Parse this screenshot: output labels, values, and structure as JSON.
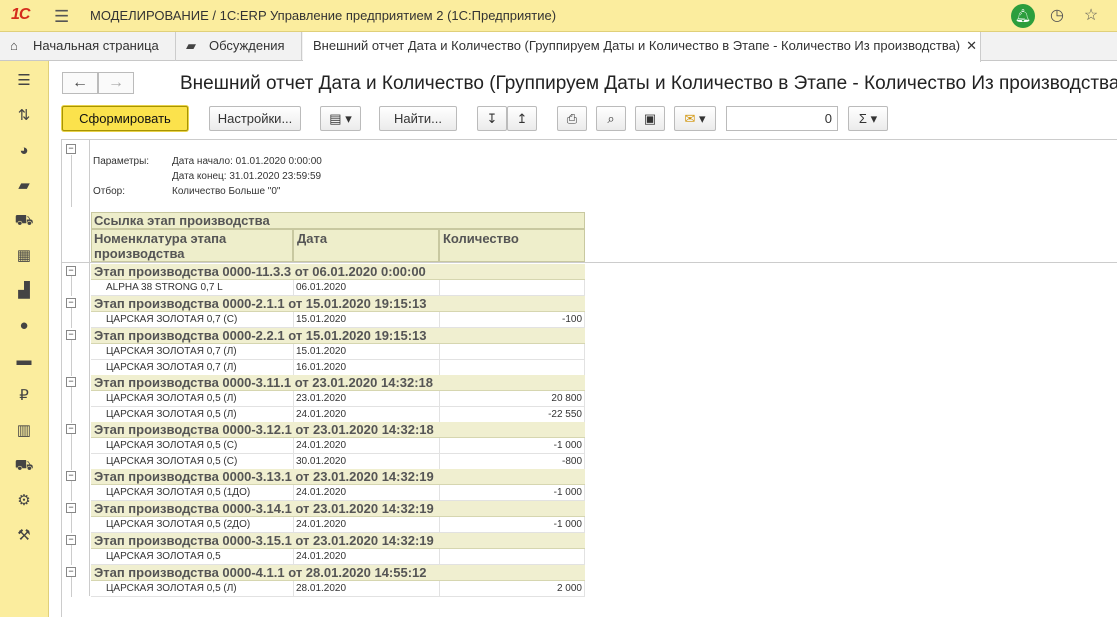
{
  "app": {
    "logo": "1С",
    "title": "МОДЕЛИРОВАНИЕ / 1С:ERP Управление предприятием 2  (1С:Предприятие)"
  },
  "tabs": [
    {
      "label": "Начальная страница",
      "icon": "home-icon"
    },
    {
      "label": "Обсуждения",
      "icon": "chat-icon"
    },
    {
      "label": "Внешний отчет Дата и Количество (Группируем Даты и Количество в Этапе - Количество Из производства)",
      "icon": ""
    }
  ],
  "page": {
    "title": "Внешний отчет Дата и Количество (Группируем Даты и Количество в Этапе - Количество Из производства)"
  },
  "toolbar": {
    "generate": "Сформировать",
    "settings": "Настройки...",
    "find": "Найти...",
    "sum_value": "0"
  },
  "params": {
    "label_params": "Параметры:",
    "date_start": "Дата начало: 01.01.2020 0:00:00",
    "date_end": "Дата конец: 31.01.2020 23:59:59",
    "label_filter": "Отбор:",
    "filter": "Количество Больше \"0\""
  },
  "table": {
    "header_group": "Ссылка этап производства",
    "col_item": "Номенклатура этапа производства",
    "col_date": "Дата",
    "col_qty": "Количество"
  },
  "groups": [
    {
      "title": "Этап производства 0000-11.3.3 от 06.01.2020 0:00:00",
      "rows": [
        {
          "item": "ALPHA 38 STRONG 0,7 L",
          "date": "06.01.2020",
          "qty": ""
        }
      ]
    },
    {
      "title": "Этап производства 0000-2.1.1 от 15.01.2020 19:15:13",
      "rows": [
        {
          "item": "ЦАРСКАЯ ЗОЛОТАЯ 0,7 (С)",
          "date": "15.01.2020",
          "qty": "-100"
        }
      ]
    },
    {
      "title": "Этап производства 0000-2.2.1 от 15.01.2020 19:15:13",
      "rows": [
        {
          "item": "ЦАРСКАЯ ЗОЛОТАЯ 0,7 (Л)",
          "date": "15.01.2020",
          "qty": ""
        },
        {
          "item": "ЦАРСКАЯ ЗОЛОТАЯ 0,7 (Л)",
          "date": "16.01.2020",
          "qty": ""
        }
      ]
    },
    {
      "title": "Этап производства 0000-3.11.1 от 23.01.2020 14:32:18",
      "rows": [
        {
          "item": "ЦАРСКАЯ ЗОЛОТАЯ 0,5 (Л)",
          "date": "23.01.2020",
          "qty": "20 800"
        },
        {
          "item": "ЦАРСКАЯ ЗОЛОТАЯ 0,5 (Л)",
          "date": "24.01.2020",
          "qty": "-22 550"
        }
      ]
    },
    {
      "title": "Этап производства 0000-3.12.1 от 23.01.2020 14:32:18",
      "rows": [
        {
          "item": "ЦАРСКАЯ ЗОЛОТАЯ 0,5 (С)",
          "date": "24.01.2020",
          "qty": "-1 000"
        },
        {
          "item": "ЦАРСКАЯ ЗОЛОТАЯ 0,5 (С)",
          "date": "30.01.2020",
          "qty": "-800"
        }
      ]
    },
    {
      "title": "Этап производства 0000-3.13.1 от 23.01.2020 14:32:19",
      "rows": [
        {
          "item": "ЦАРСКАЯ ЗОЛОТАЯ 0,5 (1ДО)",
          "date": "24.01.2020",
          "qty": "-1 000"
        }
      ]
    },
    {
      "title": "Этап производства 0000-3.14.1 от 23.01.2020 14:32:19",
      "rows": [
        {
          "item": "ЦАРСКАЯ ЗОЛОТАЯ 0,5 (2ДО)",
          "date": "24.01.2020",
          "qty": "-1 000"
        }
      ]
    },
    {
      "title": "Этап производства 0000-3.15.1 от 23.01.2020 14:32:19",
      "rows": [
        {
          "item": "ЦАРСКАЯ ЗОЛОТАЯ 0,5",
          "date": "24.01.2020",
          "qty": ""
        }
      ]
    },
    {
      "title": "Этап производства 0000-4.1.1 от 28.01.2020 14:55:12",
      "rows": [
        {
          "item": "ЦАРСКАЯ ЗОЛОТАЯ 0,5 (Л)",
          "date": "28.01.2020",
          "qty": "2 000"
        }
      ]
    }
  ]
}
